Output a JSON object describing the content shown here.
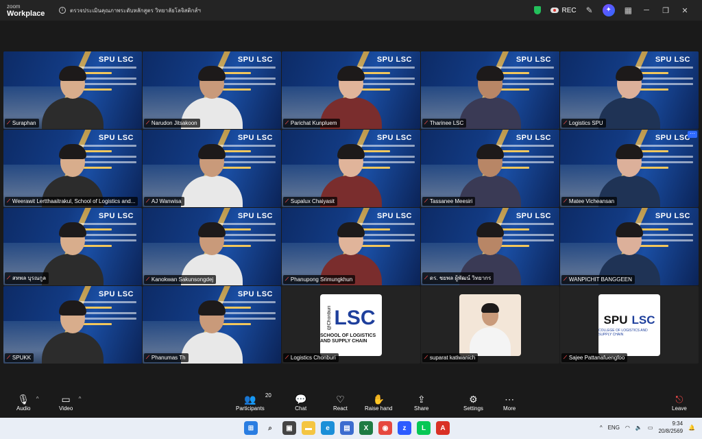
{
  "app": {
    "brand_small": "zoom",
    "brand_name": "Workplace",
    "meeting_info": "ตรวจประเมินคุณภาพระดับหลักสูตร วิทยาลัยโลจิสติกส์ฯ",
    "rec_label": "REC"
  },
  "tile_slide": {
    "logo": "SPU LSC"
  },
  "participants": [
    {
      "name": "Suraphan",
      "active": false
    },
    {
      "name": "Narudon Jitsakoon",
      "active": false
    },
    {
      "name": "Parichat Kunpluem",
      "active": false
    },
    {
      "name": "Tharinee LSC",
      "active": true
    },
    {
      "name": "Logistics SPU",
      "active": false
    },
    {
      "name": "Weerawit Lertthaaitrakul, School of Logistics and...",
      "active": false
    },
    {
      "name": "AJ Wanwisa",
      "active": false
    },
    {
      "name": "Supalux Chaiyasit",
      "active": false
    },
    {
      "name": "Tassanee Meesiri",
      "active": false
    },
    {
      "name": "Matee Vicheansan",
      "active": false
    },
    {
      "name": "สหพล บุรณกูล",
      "active": false
    },
    {
      "name": "Kanokwan Sakunsongdej",
      "active": false
    },
    {
      "name": "Phanupong Srimungkhun",
      "active": false
    },
    {
      "name": "ดร. ชยพล ผู้พัฒน์ วิทยากร",
      "active": false
    },
    {
      "name": "WANPICHIT BANGGEEN",
      "active": false
    },
    {
      "name": "SPUKK",
      "active": false
    },
    {
      "name": "Phanumas Th",
      "active": false
    },
    {
      "name": "Logistics Chonburi",
      "active": false
    },
    {
      "name": "suparat katiwanich",
      "active": false
    },
    {
      "name": "Sajee Pattanafuengfoo",
      "active": false
    }
  ],
  "cards": {
    "lsc_big": "LSC",
    "lsc_sub": "SCHOOL OF LOGISTICS AND SUPPLY CHAIN",
    "lsc_side": "@Chonburi",
    "spu_word": "SPU",
    "spu_lsc": "LSC",
    "spu_sub": "COLLEGE OF LOGISTICS AND SUPPLY CHAIN"
  },
  "toolbar": {
    "audio": "Audio",
    "video": "Video",
    "participants": "Participants",
    "participants_count": "20",
    "chat": "Chat",
    "react": "React",
    "raise_hand": "Raise hand",
    "share": "Share",
    "settings": "Settings",
    "more": "More",
    "leave": "Leave"
  },
  "taskbar": {
    "lang": "ENG",
    "time": "9:34",
    "date": "20/8/2569"
  },
  "colors": {
    "active_border": "#20d07a",
    "muted": "#ff4d4d",
    "accent": "#2f6bff"
  }
}
